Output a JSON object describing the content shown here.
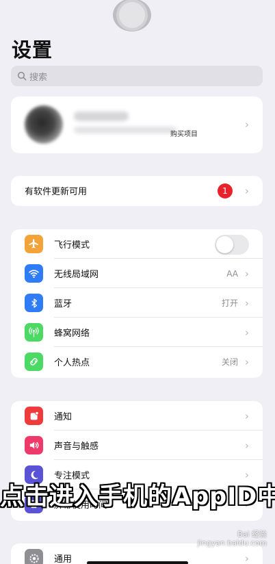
{
  "title": "设置",
  "search": {
    "placeholder": "搜索"
  },
  "profile": {
    "subtitle": "购买项目"
  },
  "update": {
    "label": "有软件更新可用",
    "badge": "1"
  },
  "network": [
    {
      "label": "飞行模式",
      "value": "",
      "icon": "airplane-icon",
      "color": "#f2a33a"
    },
    {
      "label": "无线局域网",
      "value": "AA",
      "icon": "wifi-icon",
      "color": "#2f7cf6"
    },
    {
      "label": "蓝牙",
      "value": "打开",
      "icon": "bluetooth-icon",
      "color": "#2f7cf6"
    },
    {
      "label": "蜂窝网络",
      "value": "",
      "icon": "cellular-icon",
      "color": "#4cd964"
    },
    {
      "label": "个人热点",
      "value": "关闭",
      "icon": "hotspot-icon",
      "color": "#4cd964"
    }
  ],
  "notifications": [
    {
      "label": "通知",
      "icon": "notification-icon",
      "color": "#ef3b3b"
    },
    {
      "label": "声音与触感",
      "icon": "sound-icon",
      "color": "#ee3a6a"
    },
    {
      "label": "专注模式",
      "icon": "moon-icon",
      "color": "#5b53d6"
    },
    {
      "label": "屏幕使用时间",
      "icon": "hourglass-icon",
      "color": "#5b53d6"
    }
  ],
  "general": {
    "label": "通用",
    "icon": "gear-icon",
    "color": "#8e8e93"
  },
  "caption": "点击进入手机的AppID中",
  "watermark": {
    "line1": "Bai 经验",
    "line2": "jingyan.baidu.com"
  }
}
